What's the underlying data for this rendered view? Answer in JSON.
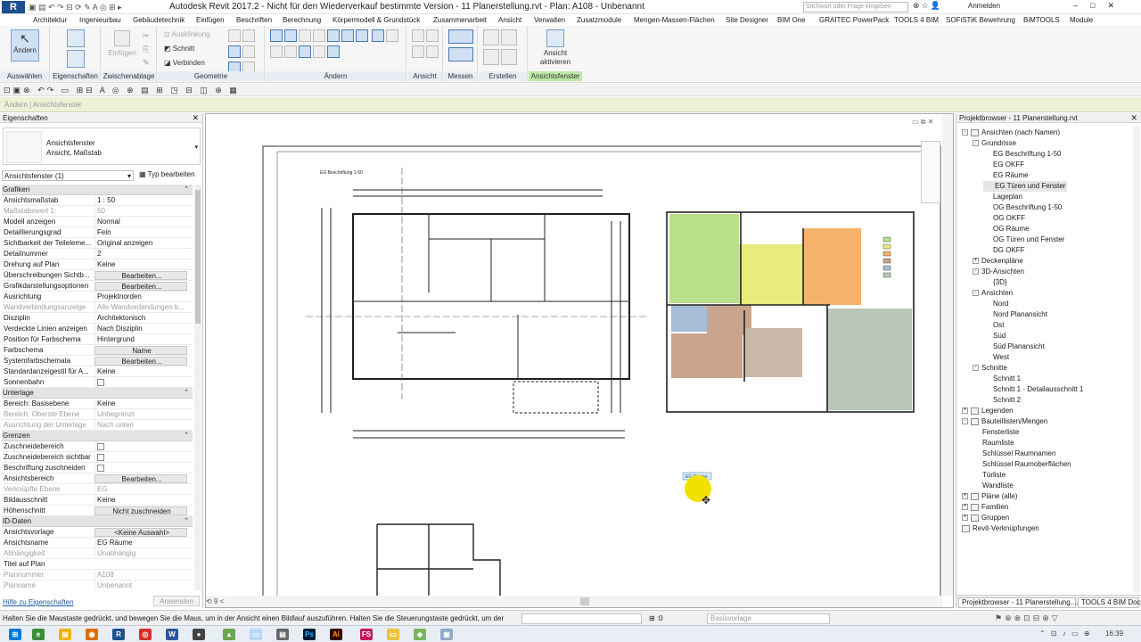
{
  "titlebar": {
    "app_logo": "R",
    "title": "Autodesk Revit 2017.2 - Nicht für den Wiederverkauf bestimmte Version -    11 Planerstellung.rvt - Plan: A108 - Unbenannt",
    "search_placeholder": "Stichwort oder Frage eingeben",
    "sign_in": "Anmelden"
  },
  "menu": {
    "tabs": [
      "Architektur",
      "Ingenieurbau",
      "Gebäudetechnik",
      "Einfügen",
      "Beschriften",
      "Berechnung",
      "Körpermodell & Grundstück",
      "Zusammenarbeit",
      "Ansicht",
      "Verwalten",
      "Zusatzmodule",
      "Mengen-Massen-Flächen",
      "Site Designer",
      "BIM One",
      "GRAITEC PowerPack",
      "TOOLS 4 BIM",
      "SOFiSTiK Bewehrung",
      "BiMTOOLS",
      "Module"
    ]
  },
  "ribbon": {
    "modify_label": "Ändern",
    "select_label": "Auswählen",
    "properties_label": "Eigenschaften",
    "clipboard_label": "Zwischenablage",
    "paste_label": "Einfügen",
    "geometry_label": "Geometrie",
    "cutout_label": "Ausklinkung",
    "cut_label": "Schnitt",
    "join_label": "Verbinden",
    "modify_panel_label": "Ändern",
    "view_label": "Ansicht",
    "measure_label": "Messen",
    "create_label": "Erstellen",
    "activate_view_label": "Ansicht aktivieren",
    "viewport_label": "Ansichtsfenster"
  },
  "options_bar": {
    "text": "Ändern | Ansichtsfenster"
  },
  "properties": {
    "title": "Eigenschaften",
    "type_name": "Ansichtsfenster",
    "type_sub": "Ansicht, Maßstab",
    "instance": "Ansichtsfenster (1)",
    "edit_type": "Typ bearbeiten",
    "help": "Hilfe zu Eigenschaften",
    "apply": "Anwenden",
    "groups": [
      {
        "name": "Grafiken",
        "rows": [
          [
            "Ansichtsmaßstab",
            "1 : 50",
            ""
          ],
          [
            "Maßstabswert 1:",
            "50",
            "dis"
          ],
          [
            "Modell anzeigen",
            "Normal",
            ""
          ],
          [
            "Detaillierungsgrad",
            "Fein",
            ""
          ],
          [
            "Sichtbarkeit der Teileleme...",
            "Original anzeigen",
            ""
          ],
          [
            "Detailnummer",
            "2",
            ""
          ],
          [
            "Drehung auf Plan",
            "Keine",
            ""
          ],
          [
            "Überschreibungen Sichtb...",
            "Bearbeiten...",
            "btn"
          ],
          [
            "Grafikdarstellungsoptionen",
            "Bearbeiten...",
            "btn"
          ],
          [
            "Ausrichtung",
            "Projektnorden",
            ""
          ],
          [
            "Wandverbindungsanzeige",
            "Alle Wandverbindungen b...",
            "dis"
          ],
          [
            "Disziplin",
            "Architektonisch",
            ""
          ],
          [
            "Verdeckte Linien anzeigen",
            "Nach Disziplin",
            ""
          ],
          [
            "Position für Farbschema",
            "Hintergrund",
            ""
          ],
          [
            "Farbschema",
            "Name",
            "btn"
          ],
          [
            "Systemfarbschemata",
            "Bearbeiten...",
            "btn"
          ],
          [
            "Standardanzeigestil für A...",
            "Keine",
            ""
          ],
          [
            "Sonnenbahn",
            "",
            "chk"
          ]
        ]
      },
      {
        "name": "Unterlage",
        "rows": [
          [
            "Bereich: Basisebene",
            "Keine",
            ""
          ],
          [
            "Bereich: Oberste Ebene",
            "Unbegrenzt",
            "dis"
          ],
          [
            "Ausrichtung der Unterlage",
            "Nach unten",
            "dis"
          ]
        ]
      },
      {
        "name": "Grenzen",
        "rows": [
          [
            "Zuschneidebereich",
            "",
            "chk"
          ],
          [
            "Zuschneidebereich sichtbar",
            "",
            "chk"
          ],
          [
            "Beschriftung zuschneiden",
            "",
            "chk"
          ],
          [
            "Ansichtsbereich",
            "Bearbeiten...",
            "btn"
          ],
          [
            "Verknüpfte Ebene",
            "EG",
            "dis"
          ],
          [
            "Bildausschnitt",
            "Keine",
            ""
          ],
          [
            "Höhenschnitt",
            "Nicht zuschneiden",
            "btn"
          ]
        ]
      },
      {
        "name": "ID-Daten",
        "rows": [
          [
            "Ansichtsvorlage",
            "<Keine Auswahl>",
            "btn"
          ],
          [
            "Ansichtsname",
            "EG Räume",
            ""
          ],
          [
            "Abhängigkeit",
            "Unabhängig",
            "dis"
          ],
          [
            "Titel auf Plan",
            "",
            ""
          ],
          [
            "Plannummer",
            "A108",
            "dis"
          ],
          [
            "Planname",
            "Unbenannt",
            "dis"
          ]
        ]
      }
    ]
  },
  "drawing": {
    "title_label": "EG Beschriftung 1-50",
    "viewport_tag": "EG Räume",
    "room_colors": {
      "green": "#b9df8a",
      "yellow": "#e8eb7d",
      "orange": "#f6b26b",
      "brown": "#c9a48c",
      "blue": "#a7bcd6",
      "gray": "#b9c7b9"
    }
  },
  "project_browser": {
    "title": "Projektbrowser - 11 Planerstellung.rvt",
    "tabs": [
      "Projektbrowser - 11 Planerstellung....",
      "TOOLS 4 BIM Dock"
    ],
    "tree": [
      {
        "label": "Ansichten (nach Namen)",
        "level": 0,
        "tog": "-",
        "icon": true
      },
      {
        "label": "Grundrisse",
        "level": 1,
        "tog": "-"
      },
      {
        "label": "EG Beschriftung 1-50",
        "level": 2
      },
      {
        "label": "EG OKFF",
        "level": 2
      },
      {
        "label": "EG Räume",
        "level": 2
      },
      {
        "label": "EG Türen und Fenster",
        "level": 2,
        "selected": true
      },
      {
        "label": "Lageplan",
        "level": 2
      },
      {
        "label": "OG Beschriftung 1-50",
        "level": 2
      },
      {
        "label": "OG OKFF",
        "level": 2
      },
      {
        "label": "OG Räume",
        "level": 2
      },
      {
        "label": "OG Türen und Fenster",
        "level": 2
      },
      {
        "label": "DG OKFF",
        "level": 2
      },
      {
        "label": "Deckenpläne",
        "level": 1,
        "tog": "+"
      },
      {
        "label": "3D-Ansichten",
        "level": 1,
        "tog": "-"
      },
      {
        "label": "{3D}",
        "level": 2
      },
      {
        "label": "Ansichten",
        "level": 1,
        "tog": "-"
      },
      {
        "label": "Nord",
        "level": 2
      },
      {
        "label": "Nord Planansicht",
        "level": 2
      },
      {
        "label": "Ost",
        "level": 2
      },
      {
        "label": "Süd",
        "level": 2
      },
      {
        "label": "Süd Planansicht",
        "level": 2
      },
      {
        "label": "West",
        "level": 2
      },
      {
        "label": "Schnitte",
        "level": 1,
        "tog": "-"
      },
      {
        "label": "Schnitt 1",
        "level": 2
      },
      {
        "label": "Schnitt 1 - Detailausschnitt 1",
        "level": 2
      },
      {
        "label": "Schnitt 2",
        "level": 2
      },
      {
        "label": "Legenden",
        "level": 0,
        "tog": "+",
        "icon": true
      },
      {
        "label": "Bauteillisten/Mengen",
        "level": 0,
        "tog": "-",
        "icon": true
      },
      {
        "label": "Fensterliste",
        "level": 1
      },
      {
        "label": "Raumliste",
        "level": 1
      },
      {
        "label": "Schlüssel Raumnamen",
        "level": 1
      },
      {
        "label": "Schlüssel Raumoberflächen",
        "level": 1
      },
      {
        "label": "Türliste",
        "level": 1
      },
      {
        "label": "Wandliste",
        "level": 1
      },
      {
        "label": "Pläne (alle)",
        "level": 0,
        "tog": "+",
        "icon": true
      },
      {
        "label": "Familien",
        "level": 0,
        "tog": "+",
        "icon": true
      },
      {
        "label": "Gruppen",
        "level": 0,
        "tog": "+",
        "icon": true
      },
      {
        "label": "Revit-Verknüpfungen",
        "level": 0,
        "icon": true
      }
    ]
  },
  "status": {
    "text": "Halten Sie die Maustaste gedrückt, und bewegen Sie die Maus, um in der Ansicht einen Bildlauf auszuführen. Halten Sie die Steuerungstaste gedrückt, um den Au",
    "zero": ":0",
    "base": "Basisvorlage"
  },
  "taskbar": {
    "time": "16:39"
  }
}
